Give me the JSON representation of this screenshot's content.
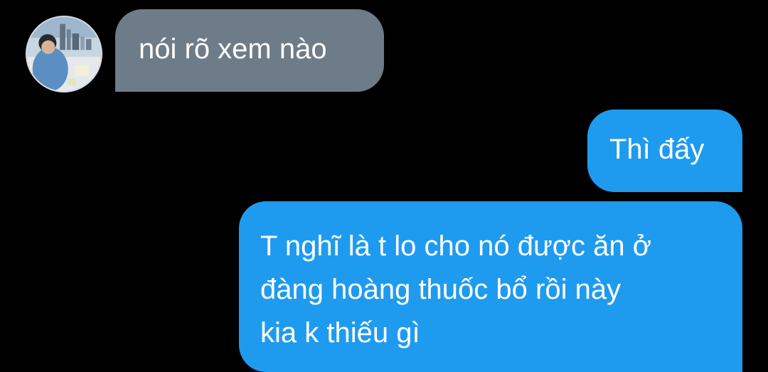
{
  "thread": {
    "contact_avatar": {
      "description": "profile-photo"
    },
    "messages": [
      {
        "direction": "incoming",
        "text": "nói rõ xem nào"
      },
      {
        "direction": "outgoing",
        "text": "Thì đấy"
      },
      {
        "direction": "outgoing",
        "lines": [
          "T nghĩ là t lo cho nó được ăn ở",
          "đàng hoàng thuốc bổ rồi này",
          "kia k thiếu gì"
        ]
      }
    ]
  },
  "colors": {
    "background": "#000000",
    "incoming_bubble": "#6e7b88",
    "outgoing_bubble": "#1e9bef",
    "text": "#ffffff"
  }
}
